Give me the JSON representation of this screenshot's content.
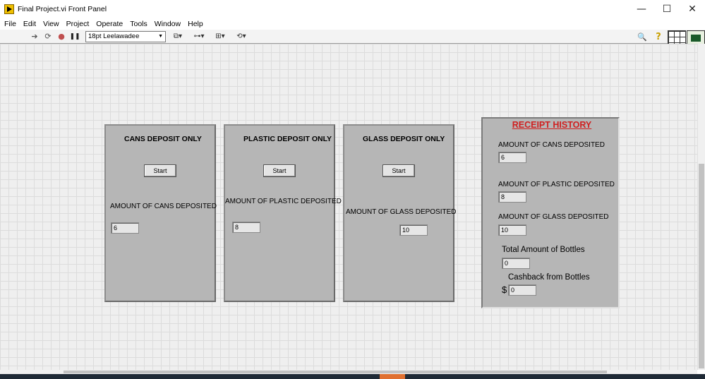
{
  "window": {
    "title": "Final Project.vi Front Panel",
    "controls": {
      "minimize": "—",
      "maximize": "☐",
      "close": "✕"
    }
  },
  "menu": [
    "File",
    "Edit",
    "View",
    "Project",
    "Operate",
    "Tools",
    "Window",
    "Help"
  ],
  "toolbar": {
    "font_select": "18pt Leelawadee",
    "dropdown_arrow": "▼",
    "run_icon": "➔",
    "run_continuous_icon": "⟳",
    "abort_icon": "●",
    "pause_icon": "❚❚",
    "align_label": "⧉▾",
    "distribute_label": "⊶▾",
    "resize_label": "⊞▾",
    "reorder_label": "⟲▾",
    "search_icon": "🔍",
    "help_icon": "?"
  },
  "boxes": {
    "cans": {
      "title": "CANS DEPOSIT ONLY",
      "button": "Start",
      "label": "AMOUNT OF CANS DEPOSITED",
      "value": "6"
    },
    "plastic": {
      "title": "PLASTIC DEPOSIT ONLY",
      "button": "Start",
      "label": "AMOUNT OF PLASTIC DEPOSITED",
      "value": "8"
    },
    "glass": {
      "title": "GLASS DEPOSIT ONLY",
      "button": "Start",
      "label": "AMOUNT OF GLASS DEPOSITED",
      "value": "10"
    }
  },
  "receipt": {
    "title": "RECEIPT HISTORY",
    "cans_label": "AMOUNT OF CANS DEPOSITED",
    "cans_value": "6",
    "plastic_label": "AMOUNT OF PLASTIC DEPOSITED",
    "plastic_value": "8",
    "glass_label": "AMOUNT OF GLASS DEPOSITED",
    "glass_value": "10",
    "total_label": "Total Amount of Bottles",
    "total_value": "0",
    "cashback_label": "Cashback from Bottles",
    "currency": "$",
    "cashback_value": "0"
  },
  "colors": {
    "accent_title": "#d02020",
    "panel_bg": "#b6b6b6",
    "grid_bg": "#efefef"
  }
}
